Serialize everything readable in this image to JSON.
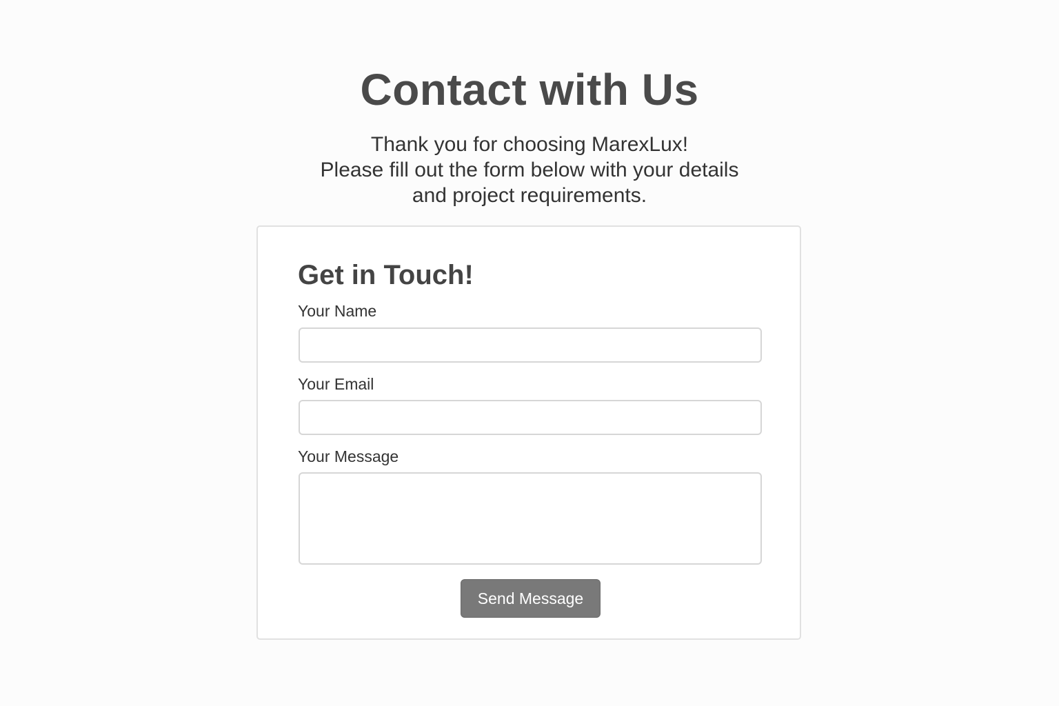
{
  "header": {
    "title": "Contact with Us",
    "intro_lines": [
      "Thank you for choosing MarexLux!",
      "Please fill out the form below with your details",
      "and project requirements."
    ]
  },
  "form": {
    "title": "Get in Touch!",
    "fields": {
      "name": {
        "label": "Your Name",
        "value": "",
        "placeholder": ""
      },
      "email": {
        "label": "Your Email",
        "value": "",
        "placeholder": ""
      },
      "message": {
        "label": "Your Message",
        "value": "",
        "placeholder": ""
      }
    },
    "submit_label": "Send Message"
  },
  "colors": {
    "background": "#fcfcfc",
    "card_background": "#ffffff",
    "card_border": "#e1e1e1",
    "input_border": "#d6d6d6",
    "button_background": "#797979",
    "button_text": "#ffffff",
    "heading_text": "#4a4a4a"
  }
}
